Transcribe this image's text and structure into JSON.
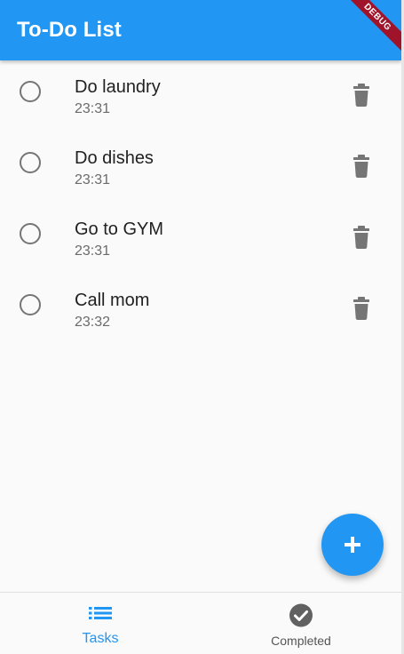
{
  "appbar": {
    "title": "To-Do List",
    "debug_banner": "DEBUG",
    "color": "#2196f3"
  },
  "tasks": [
    {
      "title": "Do laundry",
      "time": "23:31",
      "completed": false
    },
    {
      "title": "Do dishes",
      "time": "23:31",
      "completed": false
    },
    {
      "title": "Go to GYM",
      "time": "23:31",
      "completed": false
    },
    {
      "title": "Call mom",
      "time": "23:32",
      "completed": false
    }
  ],
  "icons": {
    "task_toggle": "radio-unchecked-icon",
    "task_delete": "trash-icon",
    "fab": "plus-icon",
    "nav_tasks": "list-icon",
    "nav_completed": "check-circle-icon"
  },
  "bottom_nav": {
    "items": [
      {
        "label": "Tasks",
        "active": true
      },
      {
        "label": "Completed",
        "active": false
      }
    ]
  },
  "colors": {
    "accent": "#2196f3",
    "icon_grey": "#757575",
    "debug_banner": "#a0142b"
  }
}
